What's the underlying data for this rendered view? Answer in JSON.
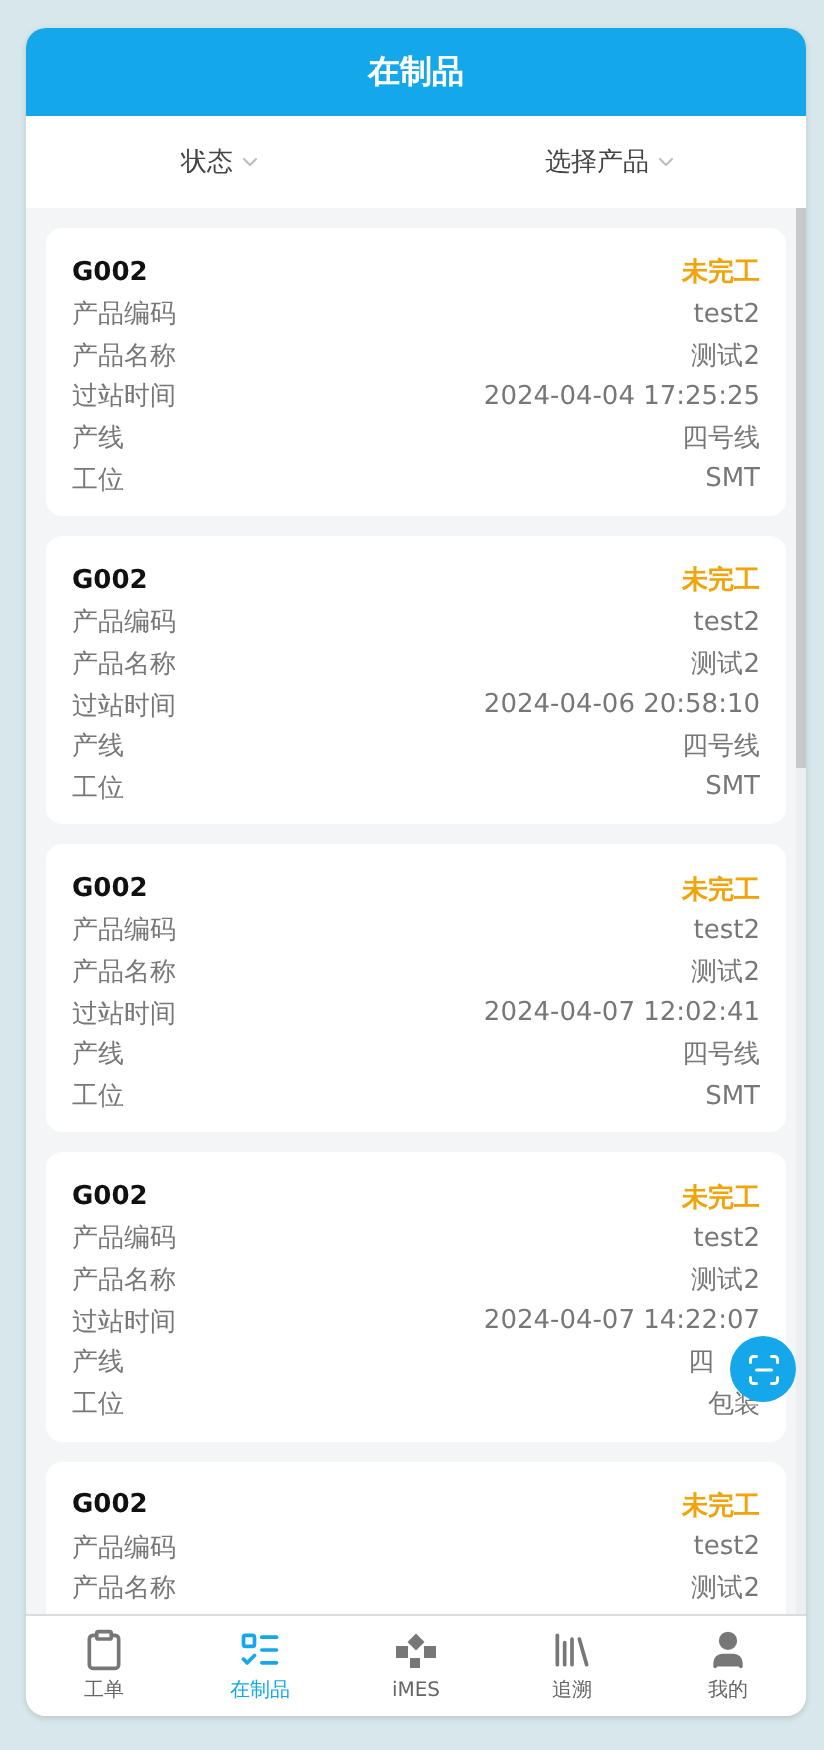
{
  "header": {
    "title": "在制品"
  },
  "filters": [
    {
      "label": "状态"
    },
    {
      "label": "选择产品"
    }
  ],
  "cards": [
    {
      "code": "G002",
      "status": "未完工",
      "rows": [
        {
          "label": "产品编码",
          "value": "test2"
        },
        {
          "label": "产品名称",
          "value": "测试2"
        },
        {
          "label": "过站时间",
          "value": "2024-04-04 17:25:25"
        },
        {
          "label": "产线",
          "value": "四号线"
        },
        {
          "label": "工位",
          "value": "SMT"
        }
      ]
    },
    {
      "code": "G002",
      "status": "未完工",
      "rows": [
        {
          "label": "产品编码",
          "value": "test2"
        },
        {
          "label": "产品名称",
          "value": "测试2"
        },
        {
          "label": "过站时间",
          "value": "2024-04-06 20:58:10"
        },
        {
          "label": "产线",
          "value": "四号线"
        },
        {
          "label": "工位",
          "value": "SMT"
        }
      ]
    },
    {
      "code": "G002",
      "status": "未完工",
      "rows": [
        {
          "label": "产品编码",
          "value": "test2"
        },
        {
          "label": "产品名称",
          "value": "测试2"
        },
        {
          "label": "过站时间",
          "value": "2024-04-07 12:02:41"
        },
        {
          "label": "产线",
          "value": "四号线"
        },
        {
          "label": "工位",
          "value": "SMT"
        }
      ]
    },
    {
      "code": "G002",
      "status": "未完工",
      "rows": [
        {
          "label": "产品编码",
          "value": "test2"
        },
        {
          "label": "产品名称",
          "value": "测试2"
        },
        {
          "label": "过站时间",
          "value": "2024-04-07 14:22:07"
        },
        {
          "label": "产线",
          "value": "四",
          "partly_covered": true
        },
        {
          "label": "工位",
          "value": "包装"
        }
      ]
    },
    {
      "code": "G002",
      "status": "未完工",
      "rows": [
        {
          "label": "产品编码",
          "value": "test2"
        },
        {
          "label": "产品名称",
          "value": "测试2"
        }
      ]
    }
  ],
  "tabs": [
    {
      "label": "工单",
      "selected": false
    },
    {
      "label": "在制品",
      "selected": true
    },
    {
      "label": "iMES",
      "selected": false
    },
    {
      "label": "追溯",
      "selected": false
    },
    {
      "label": "我的",
      "selected": false
    }
  ]
}
